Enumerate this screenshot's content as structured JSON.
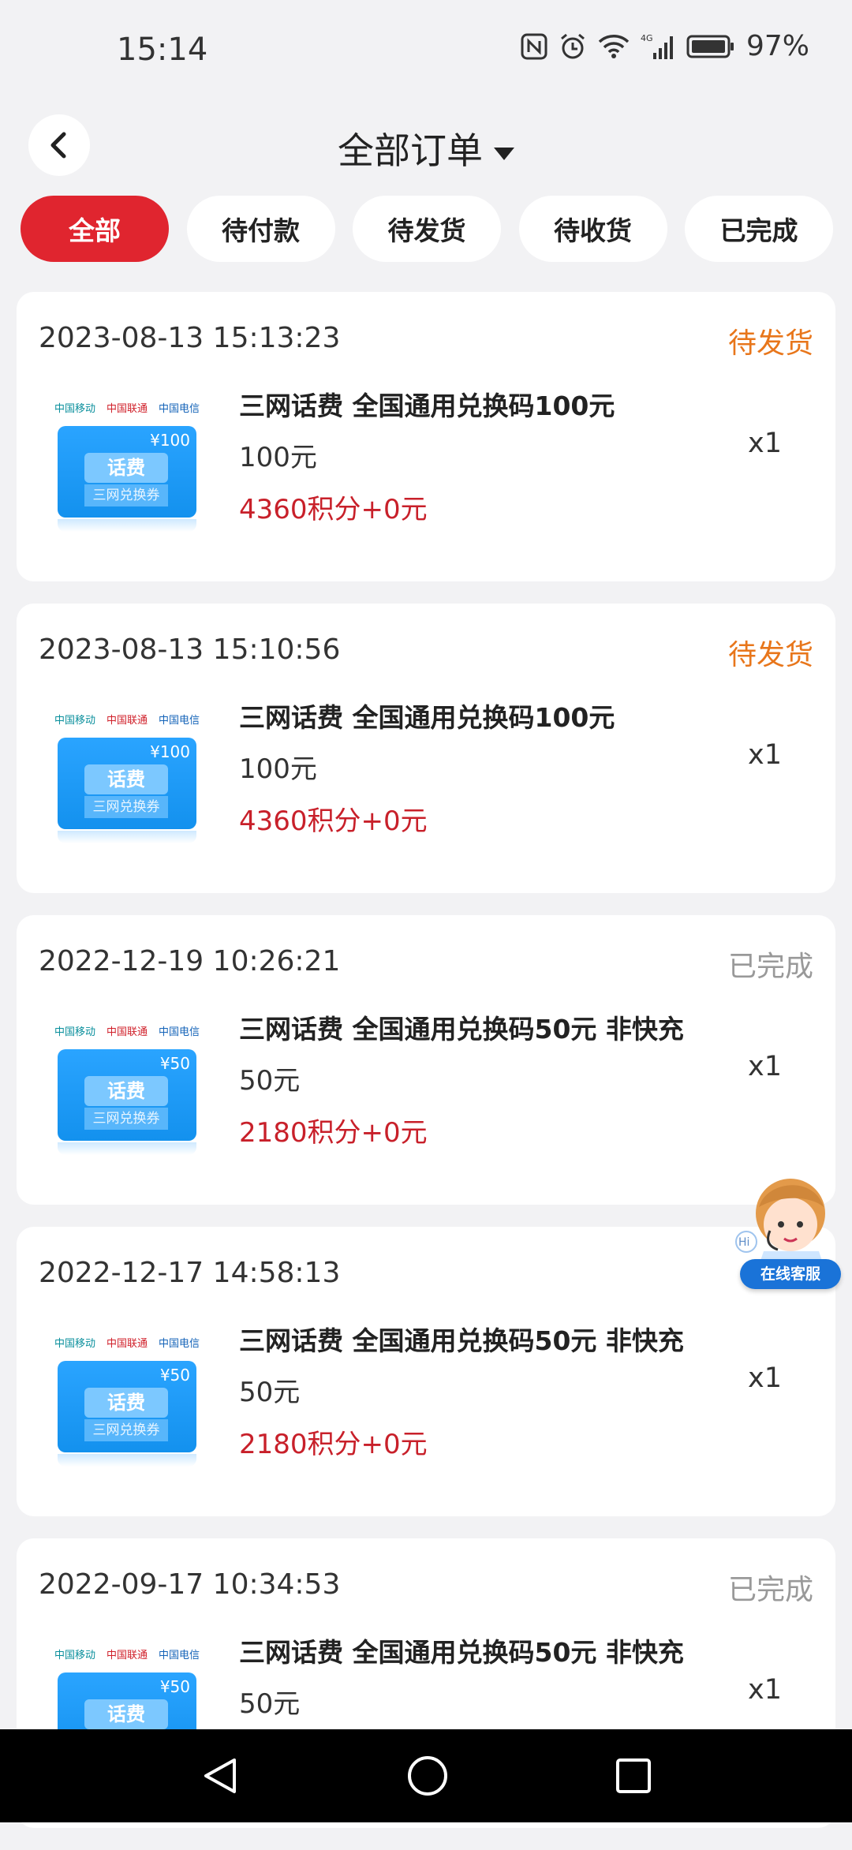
{
  "status_bar": {
    "time": "15:14",
    "battery": "97%",
    "network": "4G"
  },
  "header": {
    "title": "全部订单"
  },
  "tabs": [
    {
      "label": "全部",
      "active": true
    },
    {
      "label": "待付款",
      "active": false
    },
    {
      "label": "待发货",
      "active": false
    },
    {
      "label": "待收货",
      "active": false
    },
    {
      "label": "已完成",
      "active": false
    }
  ],
  "colors": {
    "accent": "#e0252f",
    "pending": "#e8761b",
    "done": "#999999",
    "points": "#c8202a"
  },
  "orders": [
    {
      "date": "2023-08-13 15:13:23",
      "status": "待发货",
      "status_color": "#e8761b",
      "product": "三网话费 全国通用兑换码100元",
      "price": "100元",
      "points": "4360积分+0元",
      "qty": "x1",
      "coupon_amount": "¥100",
      "coupon_tag": "话费",
      "coupon_sub": "三网兑换券"
    },
    {
      "date": "2023-08-13 15:10:56",
      "status": "待发货",
      "status_color": "#e8761b",
      "product": "三网话费 全国通用兑换码100元",
      "price": "100元",
      "points": "4360积分+0元",
      "qty": "x1",
      "coupon_amount": "¥100",
      "coupon_tag": "话费",
      "coupon_sub": "三网兑换券"
    },
    {
      "date": "2022-12-19 10:26:21",
      "status": "已完成",
      "status_color": "#999999",
      "product": "三网话费 全国通用兑换码50元 非快充",
      "price": "50元",
      "points": "2180积分+0元",
      "qty": "x1",
      "coupon_amount": "¥50",
      "coupon_tag": "话费",
      "coupon_sub": "三网兑换券"
    },
    {
      "date": "2022-12-17 14:58:13",
      "status": "",
      "status_color": "#999999",
      "product": "三网话费 全国通用兑换码50元 非快充",
      "price": "50元",
      "points": "2180积分+0元",
      "qty": "x1",
      "coupon_amount": "¥50",
      "coupon_tag": "话费",
      "coupon_sub": "三网兑换券"
    },
    {
      "date": "2022-09-17 10:34:53",
      "status": "已完成",
      "status_color": "#999999",
      "product": "三网话费 全国通用兑换码50元 非快充",
      "price": "50元",
      "points": "",
      "qty": "x1",
      "coupon_amount": "¥50",
      "coupon_tag": "话费",
      "coupon_sub": ""
    }
  ],
  "customer_service": {
    "label": "在线客服",
    "greeting": "Hi"
  },
  "logos": {
    "mobile": "中国移动",
    "unicom": "中国联通",
    "telecom": "中国电信"
  },
  "icons": {
    "back": "chevron-left-icon",
    "dropdown": "caret-down-icon"
  }
}
